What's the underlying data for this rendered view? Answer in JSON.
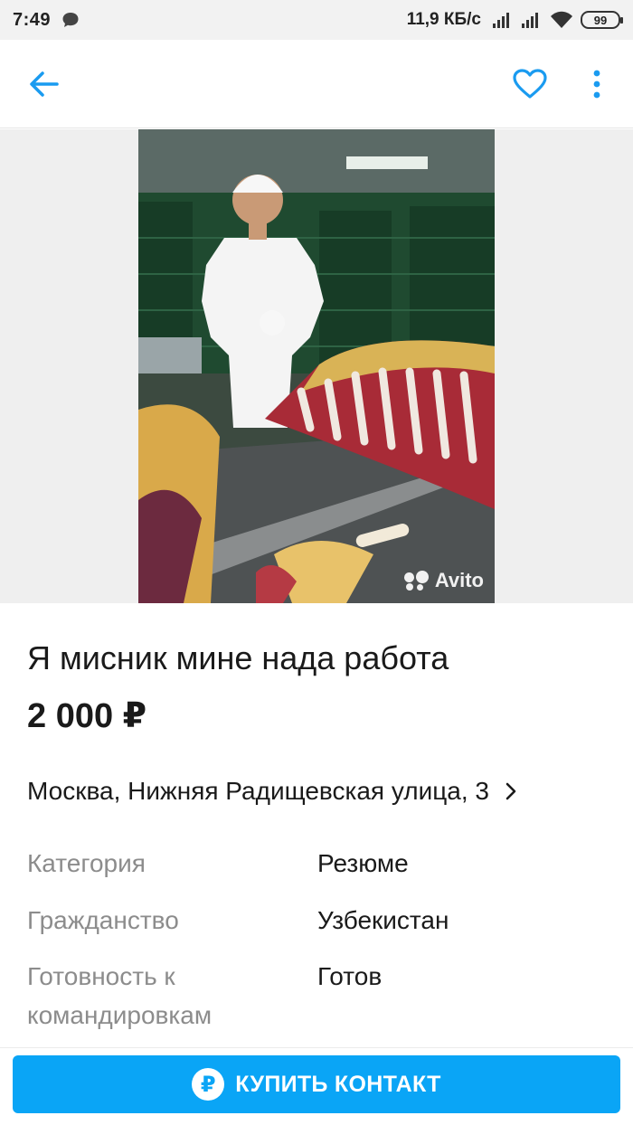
{
  "status_bar": {
    "time": "7:49",
    "speed": "11,9 КБ/с",
    "battery": "99",
    "icons": [
      "chat-notification-icon",
      "signal-icon",
      "signal-icon",
      "wifi-icon",
      "battery-icon"
    ]
  },
  "toolbar": {
    "back_icon": "arrow-left-icon",
    "favorite_icon": "heart-outline-icon",
    "more_icon": "more-vertical-icon",
    "accent_color": "#1a9bf0"
  },
  "gallery": {
    "watermark": "Avito"
  },
  "listing": {
    "title": "Я мисник мине нада работа",
    "price": "2 000 ₽",
    "address": "Москва, Нижняя Радищевская улица, 3"
  },
  "params": [
    {
      "label": "Категория",
      "value": "Резюме"
    },
    {
      "label": "Гражданство",
      "value": "Узбекистан"
    },
    {
      "label": "Готовность к командировкам",
      "value": "Готов"
    }
  ],
  "cta": {
    "label": "КУПИТЬ КОНТАКТ",
    "icon": "ruble-circle-icon",
    "color": "#0aa5f6"
  }
}
